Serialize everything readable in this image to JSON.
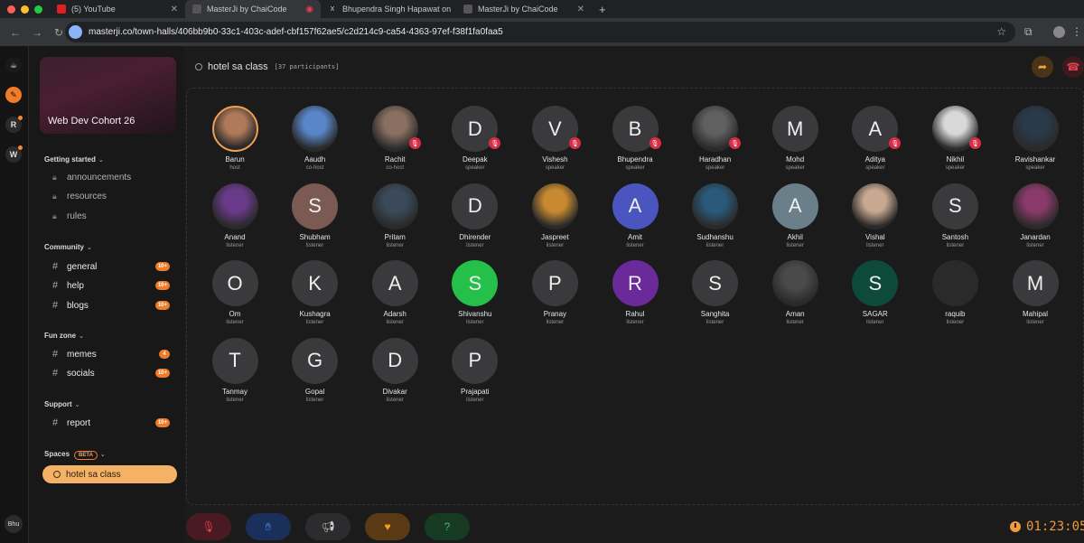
{
  "browser": {
    "tabs": [
      {
        "title": "(5) YouTube",
        "active": false
      },
      {
        "title": "MasterJi by ChaiCode",
        "active": true
      },
      {
        "title": "Bhupendra Singh Hapawat on",
        "active": false
      },
      {
        "title": "MasterJi by ChaiCode",
        "active": false
      }
    ],
    "url": "masterji.co/town-halls/406bb9b0-33c1-403c-adef-cbf157f62ae5/c2d214c9-ca54-4363-97ef-f38f1fa0faa5"
  },
  "rail": {
    "items": [
      "R",
      "W"
    ],
    "user": "Bhu"
  },
  "sidebar": {
    "cohort": "Web Dev Cohort 26",
    "getting_started": {
      "title": "Getting started",
      "items": [
        "announcements",
        "resources",
        "rules"
      ]
    },
    "community": {
      "title": "Community",
      "items": [
        {
          "label": "general",
          "badge": "10+"
        },
        {
          "label": "help",
          "badge": "10+"
        },
        {
          "label": "blogs",
          "badge": "10+"
        }
      ]
    },
    "fun_zone": {
      "title": "Fun zone",
      "items": [
        {
          "label": "memes",
          "badge": "4"
        },
        {
          "label": "socials",
          "badge": "10+"
        }
      ]
    },
    "support": {
      "title": "Support",
      "items": [
        {
          "label": "report",
          "badge": "10+"
        }
      ]
    },
    "spaces": {
      "title": "Spaces",
      "beta": "BETA",
      "active": "hotel sa class"
    }
  },
  "room": {
    "name": "hotel sa class",
    "participants": "[37 participants]"
  },
  "participants": [
    {
      "name": "Barun",
      "role": "host",
      "initial": "",
      "photo": true
    },
    {
      "name": "Aaudh",
      "role": "co-host",
      "initial": "",
      "photo": true
    },
    {
      "name": "Rachit",
      "role": "co-host",
      "initial": "",
      "photo": true,
      "muted": true
    },
    {
      "name": "Deepak",
      "role": "speaker",
      "initial": "D",
      "muted": true
    },
    {
      "name": "Vishesh",
      "role": "speaker",
      "initial": "V",
      "muted": true
    },
    {
      "name": "Bhupendra",
      "role": "speaker",
      "initial": "B",
      "muted": true
    },
    {
      "name": "Haradhan",
      "role": "speaker",
      "initial": "",
      "photo": true,
      "muted": true
    },
    {
      "name": "Mohd",
      "role": "speaker",
      "initial": "M"
    },
    {
      "name": "Aditya",
      "role": "speaker",
      "initial": "A",
      "muted": true
    },
    {
      "name": "Nikhil",
      "role": "speaker",
      "initial": "",
      "photo": true,
      "muted": true
    },
    {
      "name": "Ravishankar",
      "role": "speaker",
      "initial": "",
      "photo": true
    },
    {
      "name": "Anand",
      "role": "listener",
      "initial": "",
      "photo": true
    },
    {
      "name": "Shubham",
      "role": "listener",
      "initial": "S",
      "color": "#7a5a52"
    },
    {
      "name": "Pritam",
      "role": "listener",
      "initial": "",
      "photo": true
    },
    {
      "name": "Dhirender",
      "role": "listener",
      "initial": "D"
    },
    {
      "name": "Jaspreet",
      "role": "listener",
      "initial": "",
      "photo": true
    },
    {
      "name": "Amit",
      "role": "listener",
      "initial": "A",
      "color": "#4a55c0"
    },
    {
      "name": "Sudhanshu",
      "role": "listener",
      "initial": "",
      "photo": true
    },
    {
      "name": "Akhil",
      "role": "listener",
      "initial": "A",
      "color": "#6b7f8a"
    },
    {
      "name": "Vishal",
      "role": "listener",
      "initial": "",
      "photo": true
    },
    {
      "name": "Santosh",
      "role": "listener",
      "initial": "S"
    },
    {
      "name": "Janardan",
      "role": "listener",
      "initial": "",
      "photo": true
    },
    {
      "name": "Om",
      "role": "listener",
      "initial": "O"
    },
    {
      "name": "Kushagra",
      "role": "listener",
      "initial": "K"
    },
    {
      "name": "Adarsh",
      "role": "listener",
      "initial": "A"
    },
    {
      "name": "Shivanshu",
      "role": "listener",
      "initial": "S",
      "color": "#25c04a"
    },
    {
      "name": "Pranay",
      "role": "listener",
      "initial": "P"
    },
    {
      "name": "Rahul",
      "role": "listener",
      "initial": "R",
      "color": "#6a2a9a"
    },
    {
      "name": "Sanghita",
      "role": "listener",
      "initial": "S"
    },
    {
      "name": "Aman",
      "role": "listener",
      "initial": "",
      "photo": true
    },
    {
      "name": "SAGAR",
      "role": "listener",
      "initial": "S",
      "color": "#0e4a3a"
    },
    {
      "name": "raquib",
      "role": "listener",
      "initial": "",
      "photo": true
    },
    {
      "name": "Mahipal",
      "role": "listener",
      "initial": "M"
    },
    {
      "name": "Tanmay",
      "role": "listener",
      "initial": "T"
    },
    {
      "name": "Gopal",
      "role": "listener",
      "initial": "G"
    },
    {
      "name": "Divakar",
      "role": "listener",
      "initial": "D"
    },
    {
      "name": "Prajapati",
      "role": "listener",
      "initial": "P"
    }
  ],
  "timer": "01:23:05",
  "colors": {
    "accent": "#f07b28",
    "mute_red": "#d92d46",
    "active_space": "#f4b266"
  }
}
